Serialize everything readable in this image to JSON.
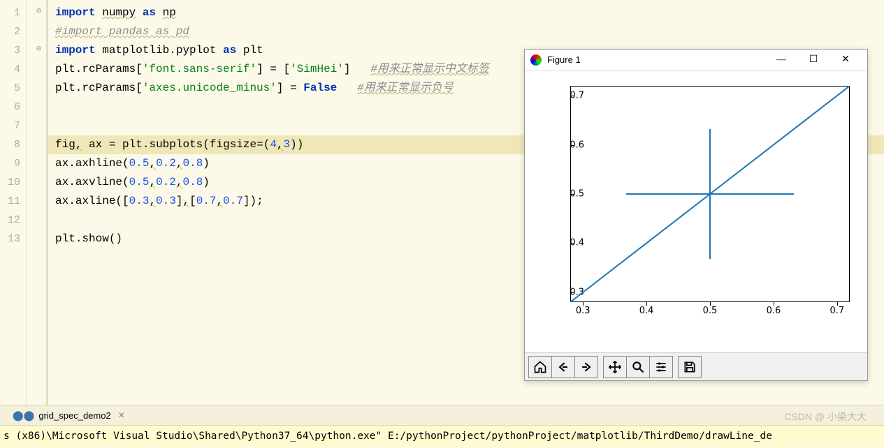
{
  "code": {
    "lines": [
      {
        "n": 1,
        "html": "<span class='kw'>import</span> <span class='id wavy'>numpy</span> <span class='kw'>as</span> <span class='id wavy'>np</span>"
      },
      {
        "n": 2,
        "html": "<span class='cmt wavy'>#import pandas as pd</span>"
      },
      {
        "n": 3,
        "html": "<span class='kw'>import</span> <span class='id'>matplotlib.pyplot</span> <span class='kw'>as</span> <span class='id'>plt</span>"
      },
      {
        "n": 4,
        "html": "<span class='id'>plt.rcParams</span>[<span class='str'>'font.sans-serif'</span>] = [<span class='str'>'SimHei'</span>]   <span class='cmt wavy'>#用来正常显示中文标签</span>"
      },
      {
        "n": 5,
        "html": "<span class='id'>plt.rcParams</span>[<span class='str'>'axes.unicode_minus'</span>] = <span class='kw'>False</span>   <span class='cmt wavy'>#用来正常显示负号</span>"
      },
      {
        "n": 6,
        "html": ""
      },
      {
        "n": 7,
        "html": ""
      },
      {
        "n": 8,
        "html": "<span class='id'>fig</span><span class='op wavy-y'>,</span> <span class='id'>ax</span> = <span class='id'>plt</span>.<span class='fn'>subplots</span>(<span class='id'>figsize</span>=(<span class='lit'>4</span><span class='op wavy-y'>,</span><span class='lit'>3</span>))"
      },
      {
        "n": 9,
        "html": "<span class='id'>ax</span>.<span class='fn'>axhline</span>(<span class='lit'>0.5</span><span class='op wavy-y'>,</span><span class='lit'>0.2</span><span class='op wavy-y'>,</span><span class='lit'>0.8</span>)"
      },
      {
        "n": 10,
        "html": "<span class='id'>ax</span>.<span class='fn'>axvline</span>(<span class='lit'>0.5</span><span class='op wavy-y'>,</span><span class='lit'>0.2</span><span class='op wavy-y'>,</span><span class='lit'>0.8</span>)"
      },
      {
        "n": 11,
        "html": "<span class='id'>ax</span>.<span class='fn'>axline</span>([<span class='lit'>0.3</span><span class='op wavy-y'>,</span><span class='lit'>0.3</span>]<span class='op wavy-y'>,</span>[<span class='lit'>0.7</span><span class='op wavy-y'>,</span><span class='lit'>0.7</span>])<span class='op'>;</span>"
      },
      {
        "n": 12,
        "html": ""
      },
      {
        "n": 13,
        "html": "<span class='id'>plt</span>.<span class='fn'>show</span>()"
      }
    ],
    "highlightLine": 8,
    "folds": {
      "1": "⊖",
      "3": "⊖"
    }
  },
  "figure": {
    "title": "Figure 1",
    "toolbar": [
      "home",
      "back",
      "forward",
      "",
      "pan",
      "zoom",
      "config",
      "",
      "save"
    ]
  },
  "chart_data": {
    "type": "line",
    "xlim": [
      0.28,
      0.72
    ],
    "ylim": [
      0.28,
      0.72
    ],
    "xticks": [
      0.3,
      0.4,
      0.5,
      0.6,
      0.7
    ],
    "yticks": [
      0.3,
      0.4,
      0.5,
      0.6,
      0.7
    ],
    "series": [
      {
        "name": "axhline",
        "kind": "hline",
        "y": 0.5,
        "xmin": 0.2,
        "xmax": 0.8
      },
      {
        "name": "axvline",
        "kind": "vline",
        "x": 0.5,
        "ymin": 0.2,
        "ymax": 0.8
      },
      {
        "name": "axline",
        "kind": "diag",
        "p1": [
          0.3,
          0.3
        ],
        "p2": [
          0.7,
          0.7
        ]
      }
    ]
  },
  "tab": {
    "name": "grid_spec_demo2"
  },
  "status": "s (x86)\\Microsoft Visual Studio\\Shared\\Python37_64\\python.exe\"  E:/pythonProject/pythonProject/matplotlib/ThirdDemo/drawLine_de",
  "watermark": "CSDN @ 小染大大"
}
